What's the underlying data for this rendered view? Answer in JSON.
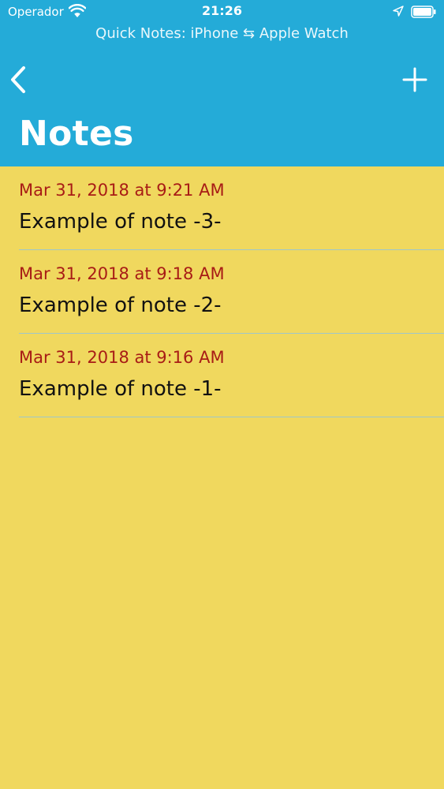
{
  "status_bar": {
    "carrier": "Operador",
    "time": "21:26",
    "icons": [
      "wifi-icon",
      "location-arrow-icon",
      "battery-icon"
    ]
  },
  "header": {
    "subtitle": "Quick Notes: iPhone ⇆ Apple Watch",
    "title": "Notes",
    "back_icon": "chevron-left-icon",
    "add_icon": "plus-icon"
  },
  "notes": [
    {
      "date": "Mar 31, 2018 at 9:21 AM",
      "title": "Example of note -3-"
    },
    {
      "date": "Mar 31, 2018 at 9:18 AM",
      "title": "Example of note -2-"
    },
    {
      "date": "Mar 31, 2018 at 9:16 AM",
      "title": "Example of note -1-"
    }
  ],
  "colors": {
    "header_bg": "#24ABD8",
    "list_bg": "#F0D85E",
    "date_text": "#A81C16",
    "separator": "#9FC7C9"
  }
}
